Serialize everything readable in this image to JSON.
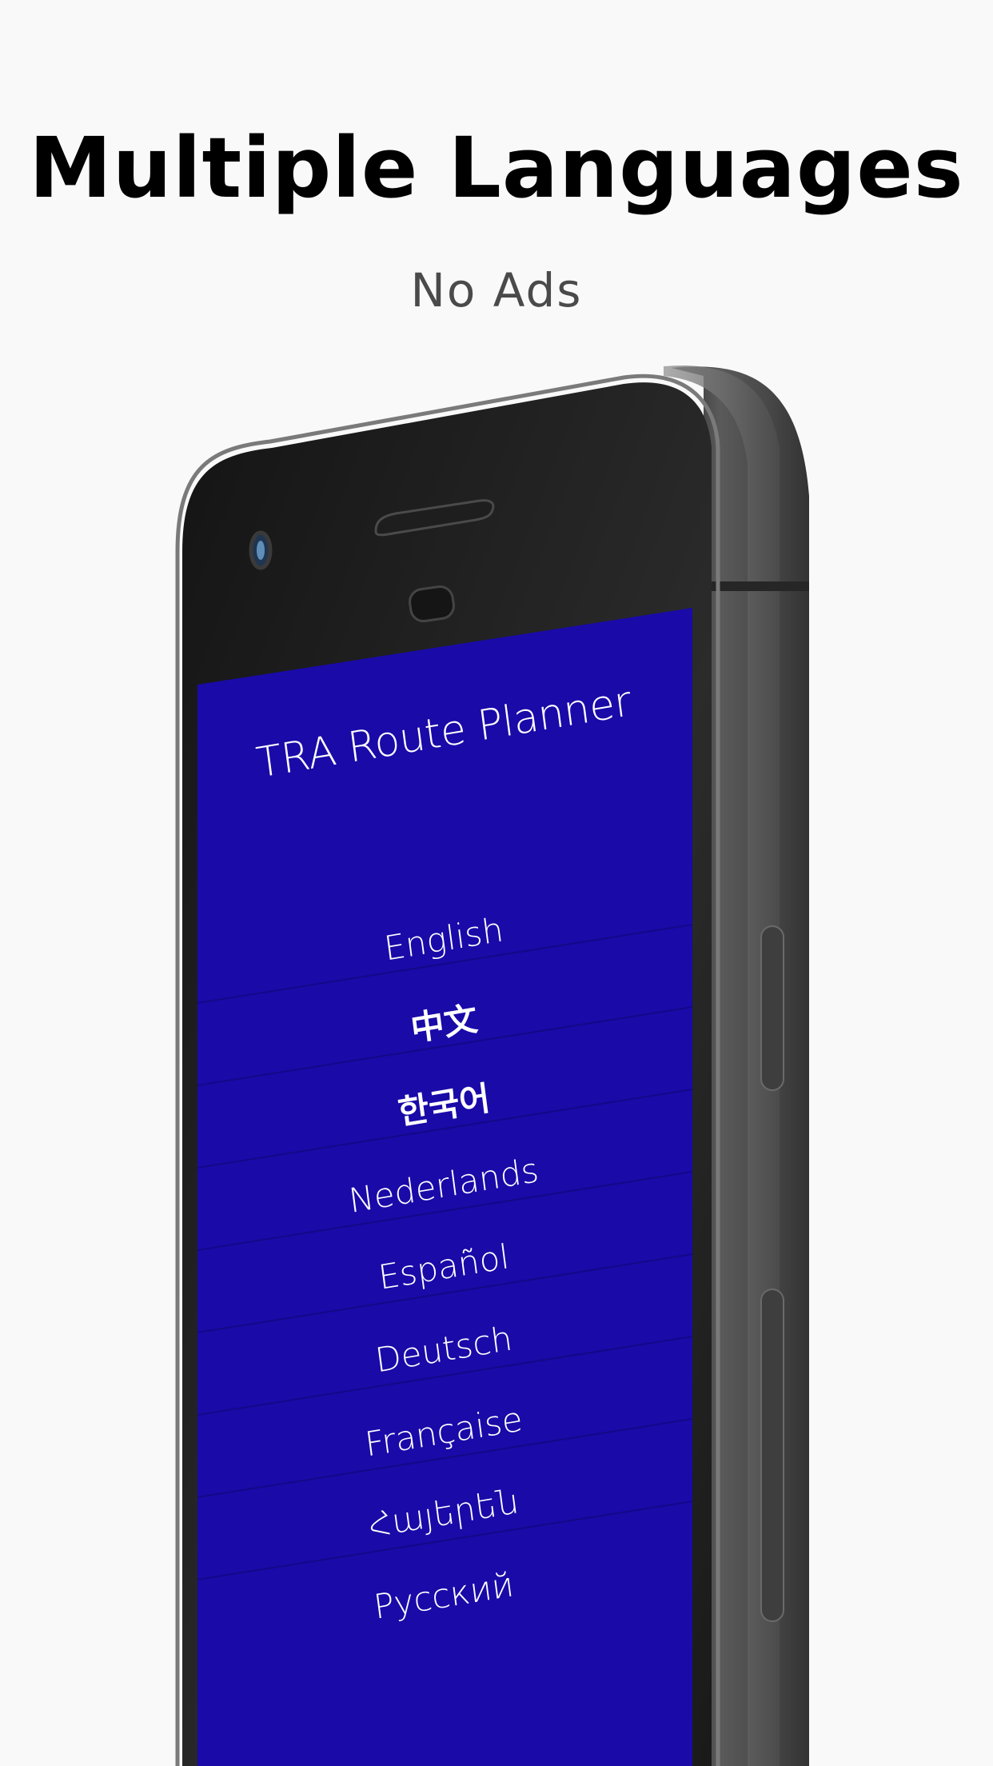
{
  "header": {
    "headline": "Multiple Languages",
    "subhead": "No Ads"
  },
  "app": {
    "title": "TRA Route Planner",
    "screen_color": "#1a0aa8",
    "languages": [
      {
        "label": "English"
      },
      {
        "label": "中文"
      },
      {
        "label": "한국어"
      },
      {
        "label": "Nederlands"
      },
      {
        "label": "Español"
      },
      {
        "label": "Deutsch"
      },
      {
        "label": "Française"
      },
      {
        "label": "Հայերեն"
      },
      {
        "label": "Русский"
      }
    ]
  }
}
